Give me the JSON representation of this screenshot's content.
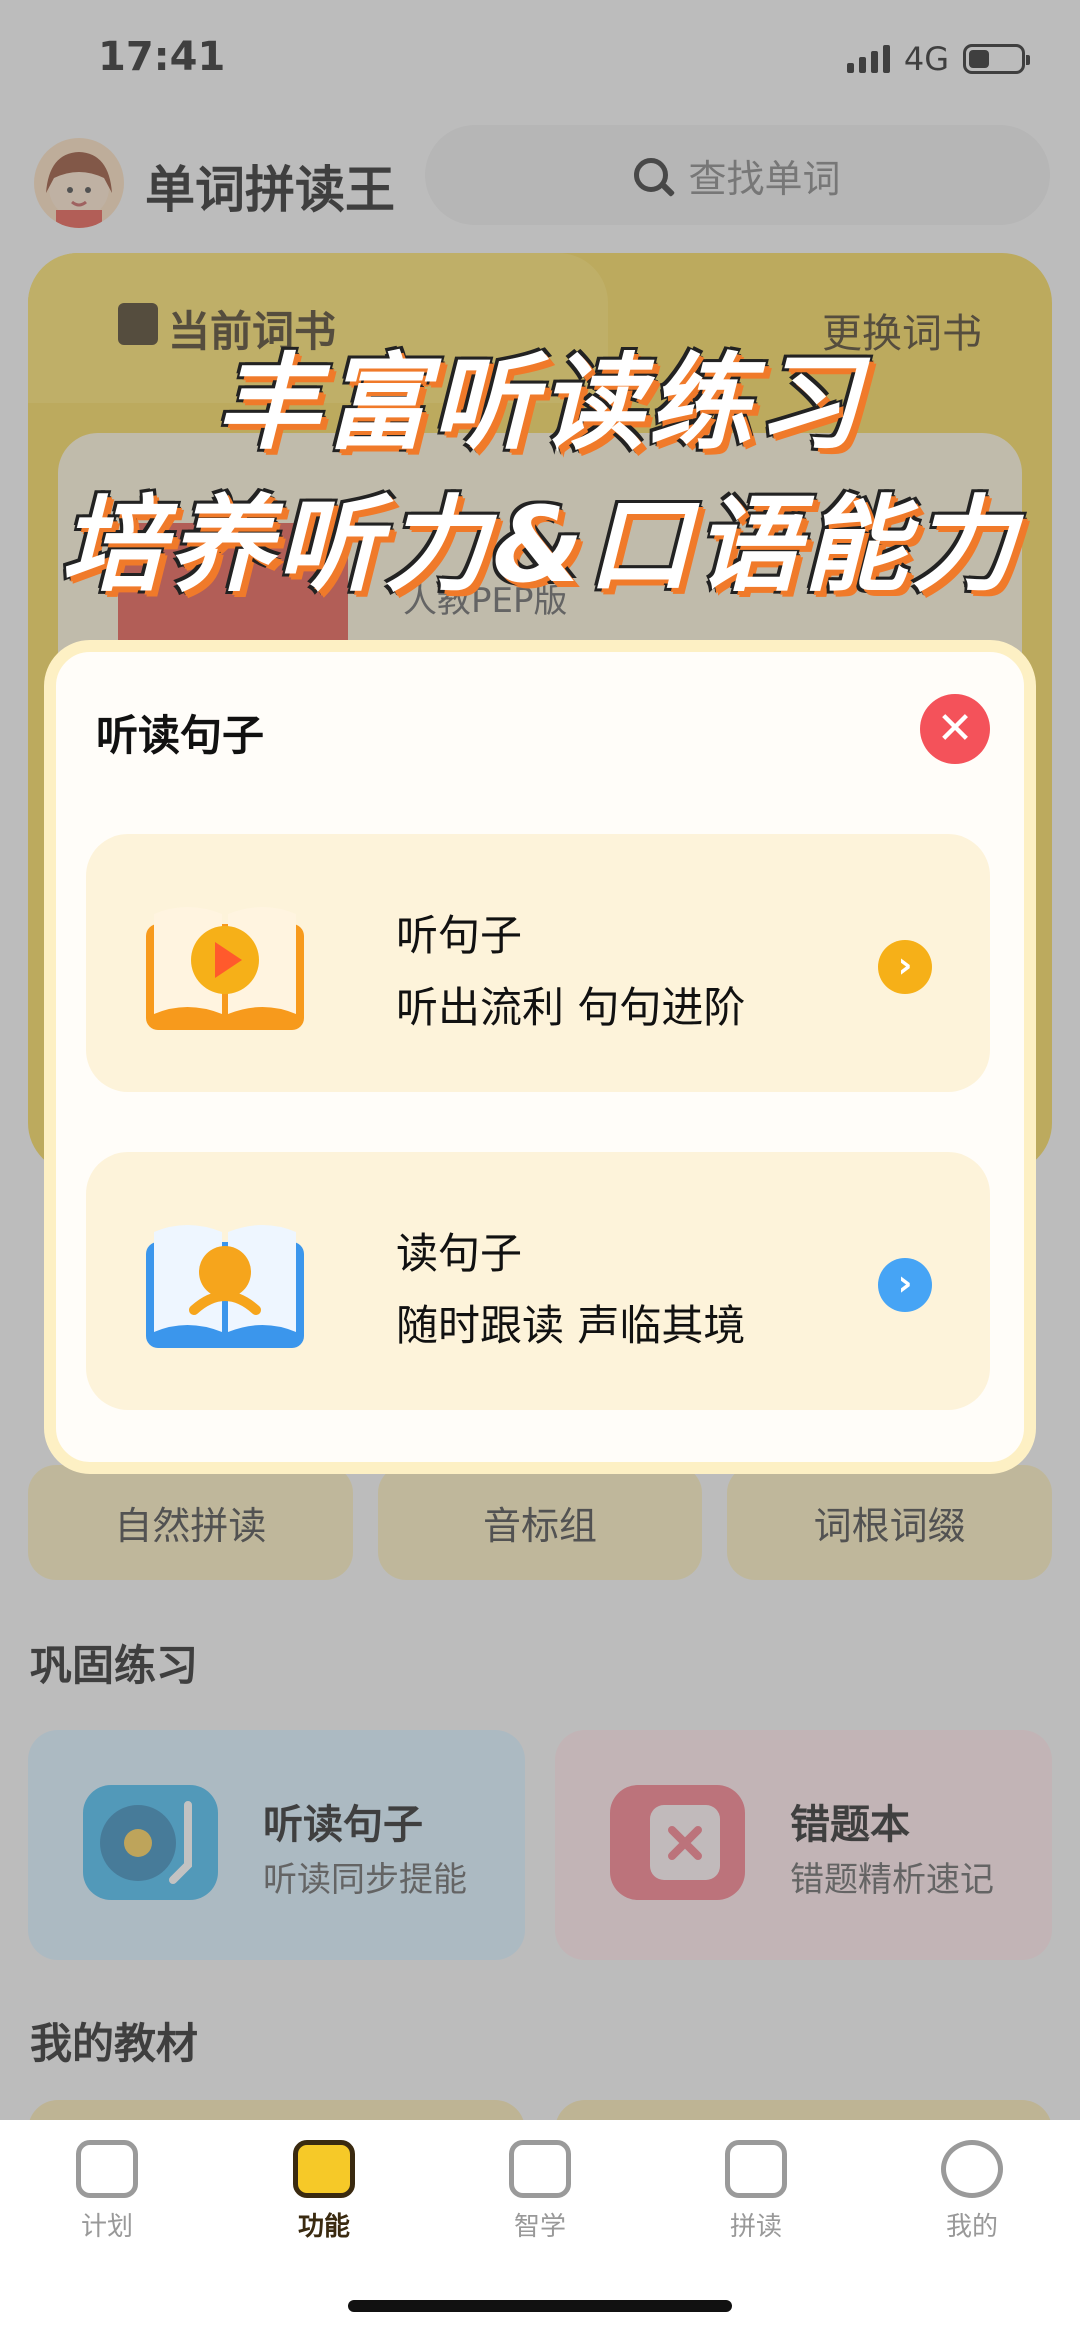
{
  "status_bar": {
    "time": "17:41",
    "network": "4G"
  },
  "header": {
    "app_title": "单词拼读王",
    "search_placeholder": "查找单词"
  },
  "book_card": {
    "tab_label": "当前词书",
    "change_label": "更换词书",
    "book_edition": "人教PEP版"
  },
  "promo": {
    "line1": "丰富听读练习",
    "line2": "培养听力&口语能力"
  },
  "modal": {
    "title": "听读句子",
    "close_icon": "close-icon",
    "options": [
      {
        "title": "听句子",
        "subtitle": "听出流利 句句进阶",
        "icon": "play-book-icon",
        "arrow_color": "#f6b018"
      },
      {
        "title": "读句子",
        "subtitle": "随时跟读 声临其境",
        "icon": "reader-book-icon",
        "arrow_color": "#46a4f5"
      }
    ]
  },
  "phonics": {
    "items": [
      "自然拼读",
      "音标组",
      "词根词缀"
    ]
  },
  "practice": {
    "title": "巩固练习",
    "cards": [
      {
        "title": "听读句子",
        "subtitle": "听读同步提能",
        "icon": "turntable-icon"
      },
      {
        "title": "错题本",
        "subtitle": "错题精析速记",
        "icon": "error-notebook-icon"
      }
    ]
  },
  "materials": {
    "title": "我的教材"
  },
  "tab_bar": {
    "items": [
      {
        "label": "计划",
        "icon": "calendar-icon"
      },
      {
        "label": "功能",
        "icon": "book-icon",
        "active": true
      },
      {
        "label": "智学",
        "icon": "robot-icon"
      },
      {
        "label": "拼读",
        "icon": "star-notebook-icon"
      },
      {
        "label": "我的",
        "icon": "smile-icon"
      }
    ]
  },
  "colors": {
    "accent_yellow": "#f6c928",
    "close_red": "#f4525a",
    "promo_orange": "#f07a2a"
  }
}
